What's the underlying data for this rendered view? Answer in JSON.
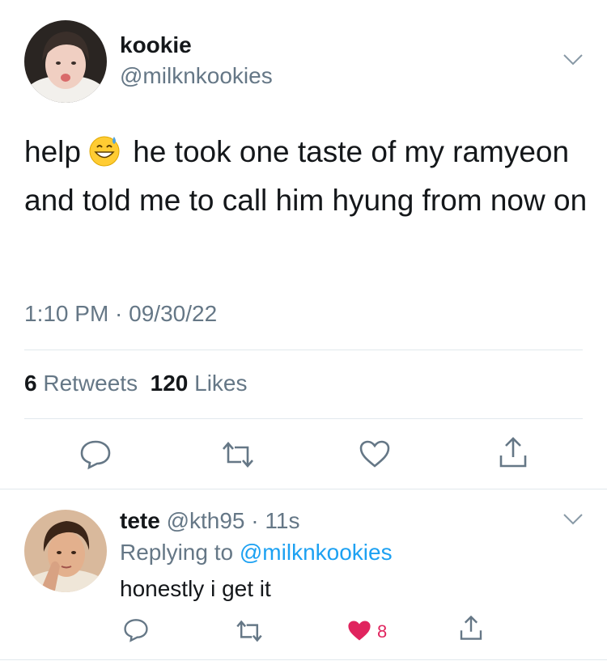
{
  "tweet": {
    "display_name": "kookie",
    "handle": "@milknkookies",
    "text_part1": "help",
    "emoji": "grinning-face-with-sweat",
    "text_part2": "he took one taste of my ramyeon and told me to call him hyung from now on",
    "timestamp": "1:10 PM · 09/30/22",
    "retweet_count": "6",
    "retweet_label": "Retweets",
    "like_count": "120",
    "like_label": "Likes"
  },
  "reply": {
    "display_name": "tete",
    "meta": "@kth95 · 11s",
    "replying_prefix": "Replying to",
    "replying_handle": "@milknkookies",
    "text": "honestly i get it",
    "like_count": "8"
  },
  "icons": [
    "chevron-down-icon",
    "reply-icon",
    "retweet-icon",
    "like-icon",
    "share-icon",
    "heart-filled-icon"
  ],
  "colors": {
    "text": "#14171a",
    "secondary": "#657786",
    "link": "#1da1f2",
    "like": "#e0245e",
    "divider": "#e1e8ed"
  }
}
